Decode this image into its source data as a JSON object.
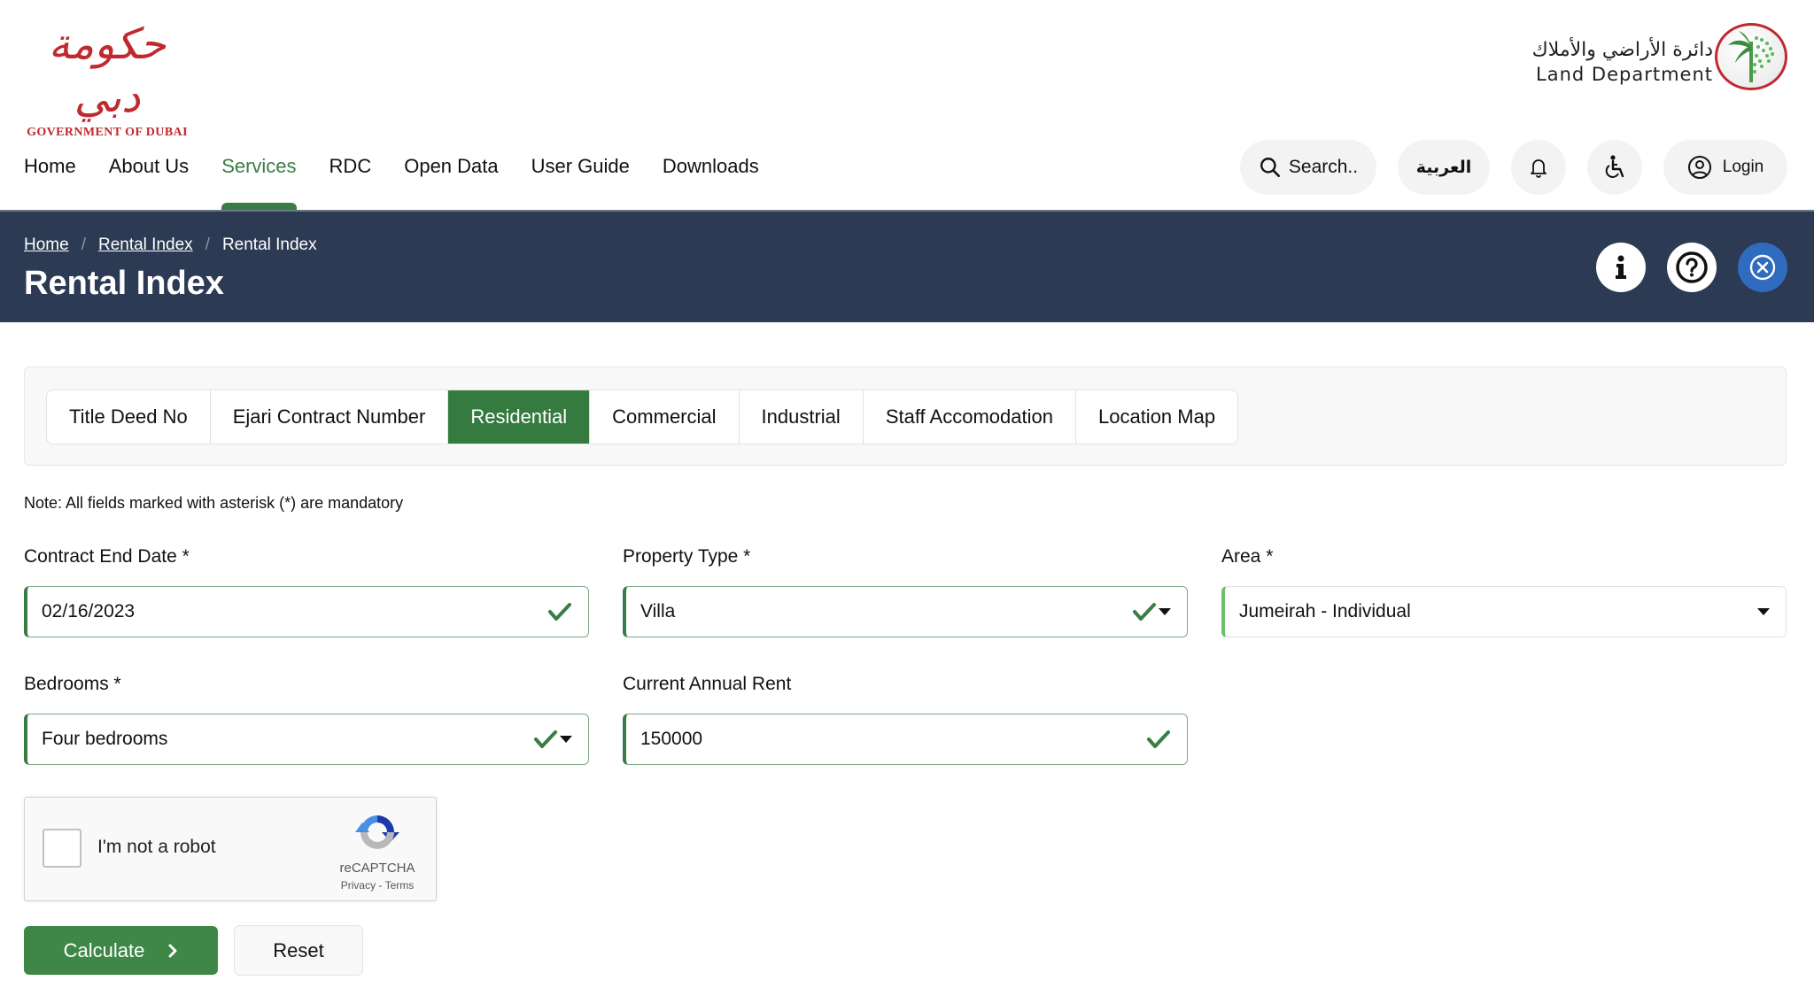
{
  "header": {
    "gov_logo": {
      "arabic": "حكومة دبي",
      "english": "GOVERNMENT OF DUBAI"
    },
    "ld_logo": {
      "arabic": "دائرة الأراضي والأملاك",
      "english": "Land Department",
      "emblem": "palm-tree-emblem"
    },
    "nav": [
      {
        "label": "Home",
        "active": false
      },
      {
        "label": "About Us",
        "active": false
      },
      {
        "label": "Services",
        "active": true
      },
      {
        "label": "RDC",
        "active": false
      },
      {
        "label": "Open Data",
        "active": false
      },
      {
        "label": "User Guide",
        "active": false
      },
      {
        "label": "Downloads",
        "active": false
      }
    ],
    "actions": {
      "search_label": "Search..",
      "language_label": "العربية",
      "notifications_icon": "bell-icon",
      "accessibility_icon": "wheelchair-icon",
      "login_label": "Login"
    }
  },
  "banner": {
    "breadcrumb": [
      {
        "label": "Home",
        "link": true
      },
      {
        "label": "Rental Index",
        "link": true
      },
      {
        "label": "Rental Index",
        "link": false
      }
    ],
    "title": "Rental Index",
    "buttons": [
      "info-icon",
      "help-icon",
      "close-icon"
    ]
  },
  "tabs": [
    {
      "label": "Title Deed No",
      "active": false
    },
    {
      "label": "Ejari Contract Number",
      "active": false
    },
    {
      "label": "Residential",
      "active": true
    },
    {
      "label": "Commercial",
      "active": false
    },
    {
      "label": "Industrial",
      "active": false
    },
    {
      "label": "Staff Accomodation",
      "active": false
    },
    {
      "label": "Location Map",
      "active": false
    }
  ],
  "form": {
    "note": "Note: All fields marked with asterisk (*) are mandatory",
    "contract_end_date": {
      "label": "Contract End Date *",
      "value": "02/16/2023",
      "valid": true
    },
    "property_type": {
      "label": "Property Type *",
      "value": "Villa",
      "valid": true
    },
    "area": {
      "label": "Area *",
      "value": "Jumeirah - Individual"
    },
    "bedrooms": {
      "label": "Bedrooms *",
      "value": "Four bedrooms",
      "valid": true
    },
    "current_annual_rent": {
      "label": "Current Annual Rent",
      "value": "150000",
      "valid": true
    }
  },
  "captcha": {
    "label": "I'm not a robot",
    "checked": false,
    "brand": "reCAPTCHA",
    "privacy": "Privacy",
    "separator": " - ",
    "terms": "Terms"
  },
  "buttons": {
    "calculate": "Calculate",
    "reset": "Reset"
  },
  "colors": {
    "accent_green": "#357a3f",
    "banner_navy": "#2c3a53",
    "close_blue": "#2f6bbf",
    "logo_red": "#c0292e"
  }
}
